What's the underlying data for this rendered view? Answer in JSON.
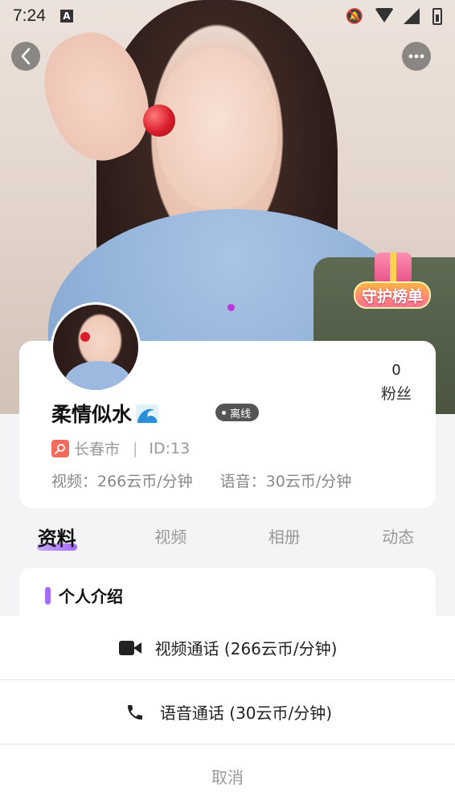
{
  "status_bar": {
    "time": "7:24",
    "app_icon_letter": "A"
  },
  "hero": {
    "guard_badge_label": "守护榜单",
    "carousel_active_color": "#c035e0"
  },
  "profile": {
    "fans_count": "0",
    "fans_label": "粉丝",
    "nickname": "柔情似水",
    "status": "离线",
    "city": "长春市",
    "id_text": "ID:13",
    "video_price": "视频：266云币/分钟",
    "voice_price": "语音：30云币/分钟"
  },
  "tabs": [
    {
      "label": "资料",
      "active": true
    },
    {
      "label": "视频",
      "active": false
    },
    {
      "label": "相册",
      "active": false
    },
    {
      "label": "动态",
      "active": false
    }
  ],
  "intro": {
    "title": "个人介绍"
  },
  "sheet": {
    "video_call": "视频通话 (266云币/分钟)",
    "voice_call": "语音通话 (30云币/分钟)",
    "cancel": "取消"
  },
  "colors": {
    "accent": "#a46cff",
    "location_badge": "#f36b5b",
    "offline_badge": "#555555"
  }
}
